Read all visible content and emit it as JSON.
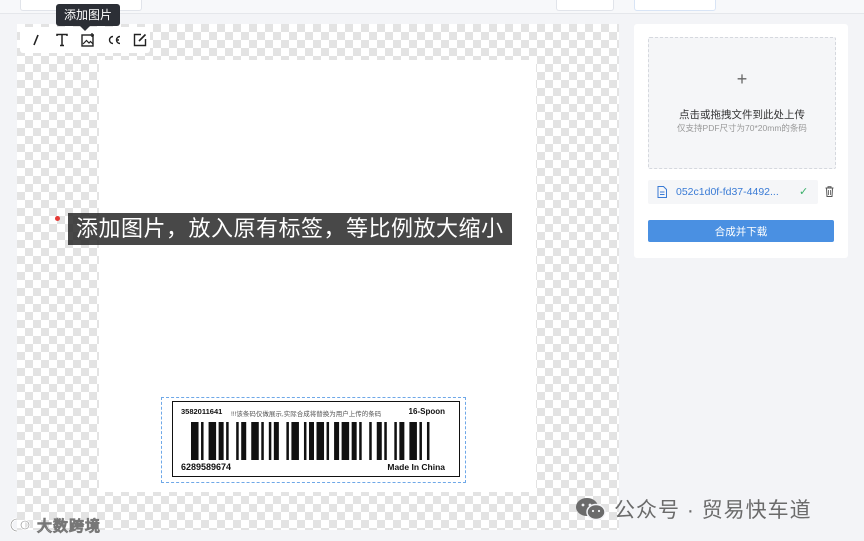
{
  "tooltip": {
    "text": "添加图片"
  },
  "toolbar": {
    "tools": [
      {
        "icon": "line-icon"
      },
      {
        "icon": "text-icon"
      },
      {
        "icon": "add-image-icon"
      },
      {
        "icon": "ce-mark-icon"
      },
      {
        "icon": "edit-icon"
      }
    ]
  },
  "caption": {
    "text": "添加图片，放入原有标签，等比例放大缩小"
  },
  "label": {
    "top_left": "3582011641",
    "note": "!!!该条码仅做展示,实际合成将替换为用户上传的条码",
    "top_right": "16-Spoon",
    "bottom_left": "6289589674",
    "bottom_right": "Made In China"
  },
  "upload": {
    "plus": "+",
    "title": "点击或拖拽文件到此处上传",
    "subtitle": "仅支持PDF尺寸为70*20mm的条码"
  },
  "file": {
    "name": "052c1d0f-fd37-4492...",
    "status_icon": "check-icon"
  },
  "actions": {
    "download_label": "合成并下载"
  },
  "watermark": {
    "left": "大数跨境",
    "right": "公众号 · 贸易快车道"
  },
  "colors": {
    "accent": "#4a90e2",
    "success": "#3ab06a",
    "caption_bg": "#282828"
  }
}
